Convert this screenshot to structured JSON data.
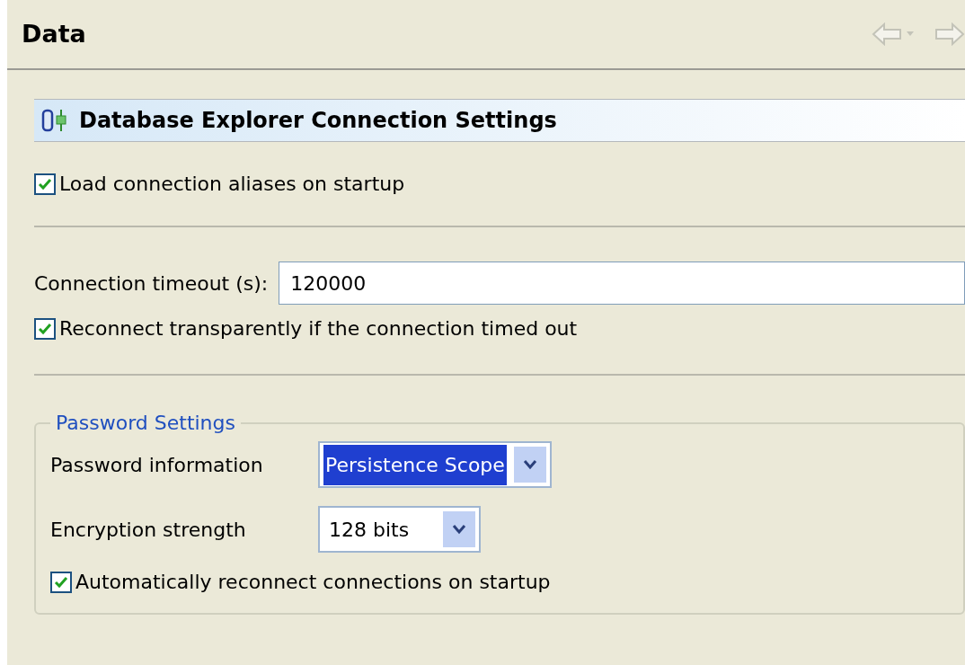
{
  "page": {
    "title": "Data"
  },
  "section": {
    "title": "Database Explorer Connection Settings"
  },
  "load_aliases": {
    "label": "Load connection aliases on startup",
    "checked": true
  },
  "timeout": {
    "label": "Connection timeout (s):",
    "value": "120000"
  },
  "reconnect": {
    "label": "Reconnect transparently if the connection timed out",
    "checked": true
  },
  "password_settings": {
    "title": "Password Settings",
    "fields": [
      {
        "label": "Password information",
        "value": "Persistence Scope",
        "focused": true
      },
      {
        "label": "Encryption strength",
        "value": "128 bits",
        "focused": false
      }
    ],
    "auto_reconnect": {
      "label": "Automatically reconnect connections on startup",
      "checked": true
    }
  }
}
